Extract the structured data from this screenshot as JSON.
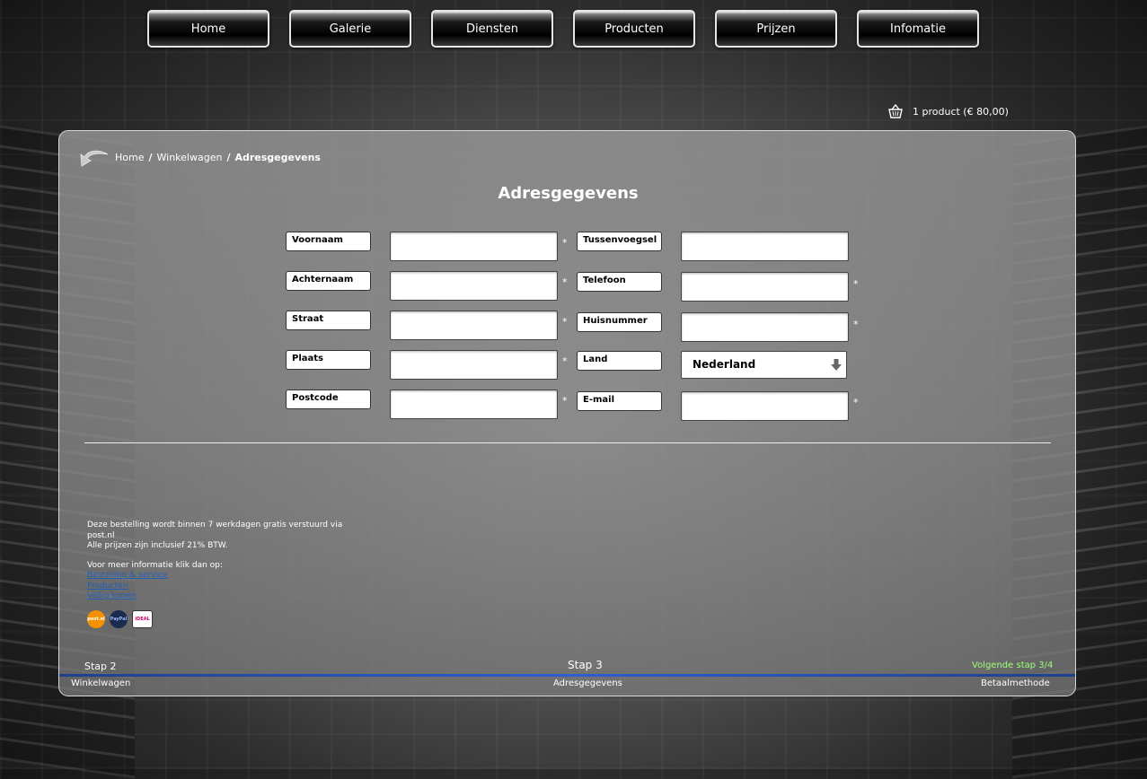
{
  "nav": [
    "Home",
    "Galerie",
    "Diensten",
    "Producten",
    "Prijzen",
    "Infomatie"
  ],
  "cart": {
    "icon": "basket-icon",
    "text": "1 product (€ 80,00)"
  },
  "breadcrumb": {
    "icon": "back-arrow-icon",
    "home": "Home",
    "cart": "Winkelwagen",
    "current": "Adresgegevens",
    "separator": "/"
  },
  "title": "Adresgegevens",
  "form": {
    "required_mark": "*",
    "left": [
      {
        "label": "Voornaam",
        "value": "",
        "required": true
      },
      {
        "label": "Achternaam",
        "value": "",
        "required": true
      },
      {
        "label": "Straat",
        "value": "",
        "required": true
      },
      {
        "label": "Plaats",
        "value": "",
        "required": true
      },
      {
        "label": "Postcode",
        "value": "",
        "required": true
      }
    ],
    "right": [
      {
        "label": "Tussenvoegsel",
        "value": "",
        "required": false
      },
      {
        "label": "Telefoon",
        "value": "",
        "required": true
      },
      {
        "label": "Huisnummer",
        "value": "",
        "required": true
      },
      {
        "label": "Land",
        "value": "Nederland",
        "type": "select",
        "required": false
      },
      {
        "label": "E-mail",
        "value": "",
        "required": true
      }
    ]
  },
  "info": {
    "line1": "Deze bestelling wordt binnen 7 werkdagen gratis verstuurd via post.nl",
    "line2": "Alle prijzen zijn inclusief 21% BTW.",
    "more": "Voor meer informatie klik dan op:",
    "links": [
      "Bestelling & service",
      "Producten",
      "Veilig kopen"
    ]
  },
  "payment_logos": [
    {
      "name": "postnl-logo",
      "text": "post.nl"
    },
    {
      "name": "paypal-logo",
      "text": "PayPal"
    },
    {
      "name": "ideal-logo",
      "text": "iDEAL"
    }
  ],
  "steps": {
    "prev": "Stap 2",
    "prev_name": "Winkelwagen",
    "current": "Stap 3",
    "current_name": "Adresgegevens",
    "next": "Volgende stap 3/4",
    "next_name": "Betaalmethode"
  },
  "colors": {
    "steps_bar": "#2d5ed1",
    "next_step": "#9cff78",
    "link": "#1f5fb8"
  }
}
